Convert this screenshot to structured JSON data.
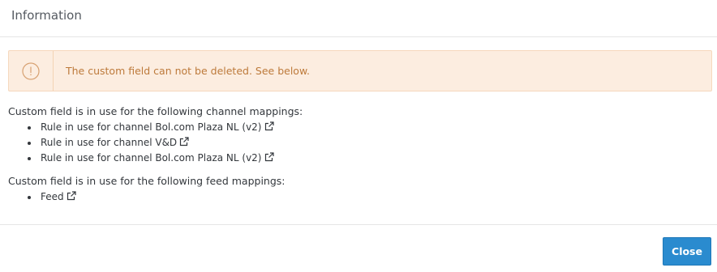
{
  "modal": {
    "title": "Information"
  },
  "alert": {
    "icon": "exclamation-circle-icon",
    "message": "The custom field can not be deleted. See below."
  },
  "channel_mappings": {
    "title": "Custom field is in use for the following channel mappings:",
    "items": [
      {
        "label": "Rule in use for channel Bol.com Plaza NL (v2)",
        "icon": "external-link-icon"
      },
      {
        "label": "Rule in use for channel V&D",
        "icon": "external-link-icon"
      },
      {
        "label": "Rule in use for channel Bol.com Plaza NL (v2)",
        "icon": "external-link-icon"
      }
    ]
  },
  "feed_mappings": {
    "title": "Custom field is in use for the following feed mappings:",
    "items": [
      {
        "label": "Feed",
        "icon": "external-link-icon"
      }
    ]
  },
  "footer": {
    "close_label": "Close"
  },
  "colors": {
    "alert_background": "#fcede0",
    "alert_text": "#bd7a3b",
    "primary_button": "#2a8bcf"
  }
}
